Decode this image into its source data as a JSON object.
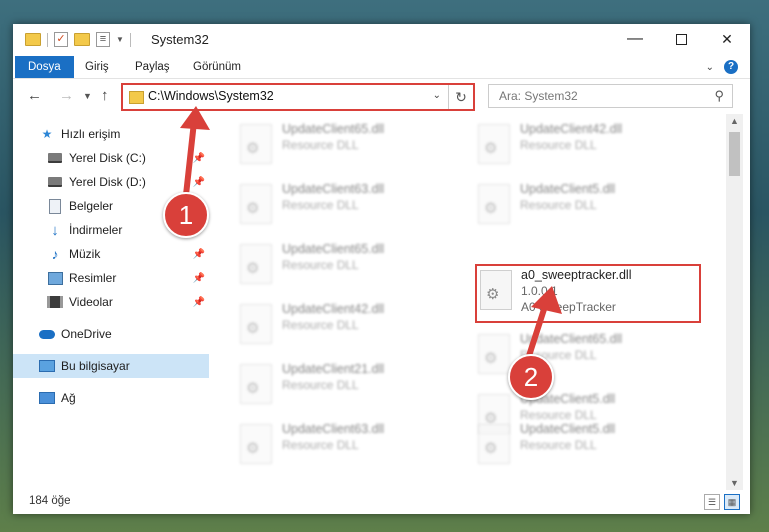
{
  "window": {
    "title": "System32",
    "controls": {
      "minimize": "—",
      "maximize": "",
      "close": "✕"
    }
  },
  "ribbon": {
    "tabs": [
      "Dosya",
      "Giriş",
      "Paylaş",
      "Görünüm"
    ],
    "help": "?",
    "expand": "⌄"
  },
  "address": {
    "path": "C:\\Windows\\System32",
    "search_placeholder": "Ara: System32"
  },
  "sidebar": {
    "items": [
      {
        "label": "Hızlı erişim",
        "icon": "star-icon"
      },
      {
        "label": "Yerel Disk (C:)",
        "icon": "drive-icon",
        "pinned": true
      },
      {
        "label": "Yerel Disk (D:)",
        "icon": "drive-icon",
        "pinned": true
      },
      {
        "label": "Belgeler",
        "icon": "document-icon",
        "pinned": true
      },
      {
        "label": "İndirmeler",
        "icon": "download-icon",
        "pinned": true
      },
      {
        "label": "Müzik",
        "icon": "music-icon",
        "pinned": true
      },
      {
        "label": "Resimler",
        "icon": "pictures-icon",
        "pinned": true
      },
      {
        "label": "Videolar",
        "icon": "videos-icon",
        "pinned": true
      },
      {
        "label": "OneDrive",
        "icon": "cloud-icon"
      },
      {
        "label": "Bu bilgisayar",
        "icon": "computer-icon",
        "selected": true
      },
      {
        "label": "Ağ",
        "icon": "network-icon"
      }
    ]
  },
  "files": [
    {
      "name": "UpdateClient65.dll",
      "type": "Resource DLL",
      "blurred": true
    },
    {
      "name": "UpdateClient42.dll",
      "type": "Resource DLL",
      "blurred": true
    },
    {
      "name": "UpdateClient63.dll",
      "type": "Resource DLL",
      "blurred": true
    },
    {
      "name": "UpdateClient5.dll",
      "type": "Resource DLL",
      "blurred": true
    },
    {
      "name": "UpdateClient65.dll",
      "type": "Resource DLL",
      "blurred": true
    },
    {
      "name": "a0_sweeptracker.dll",
      "version": "1.0.0.1",
      "type": "A0 SweepTracker",
      "blurred": false,
      "highlighted": true
    },
    {
      "name": "UpdateClient42.dll",
      "type": "Resource DLL",
      "blurred": true
    },
    {
      "name": "UpdateClient65.dll",
      "type": "Resource DLL",
      "blurred": true
    },
    {
      "name": "UpdateClient21.dll",
      "type": "Resource DLL",
      "blurred": true
    },
    {
      "name": "UpdateClient5.dll",
      "type": "Resource DLL",
      "blurred": true
    },
    {
      "name": "UpdateClient63.dll",
      "type": "Resource DLL",
      "blurred": true
    },
    {
      "name": "UpdateClient5.dll",
      "type": "Resource DLL",
      "blurred": true
    }
  ],
  "status": {
    "item_count": "184 öğe"
  },
  "annotations": {
    "step1": "1",
    "step2": "2",
    "color": "#d9403a"
  }
}
